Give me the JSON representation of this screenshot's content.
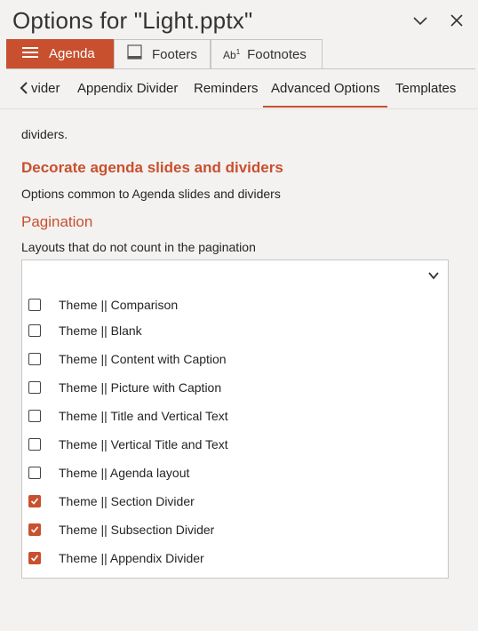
{
  "window": {
    "title": "Options for \"Light.pptx\""
  },
  "main_tabs": [
    {
      "label": "Agenda",
      "icon": "hamburger-icon",
      "active": true
    },
    {
      "label": "Footers",
      "icon": "footer-icon",
      "active": false
    },
    {
      "label": "Footnotes",
      "icon": "footnote-icon",
      "active": false
    }
  ],
  "sub_tabs": [
    {
      "label": "vider"
    },
    {
      "label": "Appendix Divider"
    },
    {
      "label": "Reminders"
    },
    {
      "label": "Advanced Options",
      "active": true
    },
    {
      "label": "Templates"
    }
  ],
  "footnotes_icon_text": "Ab",
  "content": {
    "dividers_text": "dividers.",
    "decorate_heading": "Decorate agenda slides and dividers",
    "common_text": "Options common to Agenda slides and dividers",
    "pagination_heading": "Pagination",
    "layouts_label": "Layouts that do not count in the pagination",
    "dropdown_value": ""
  },
  "layouts": [
    {
      "label": "Theme || Comparison",
      "checked": false
    },
    {
      "label": "Theme || Blank",
      "checked": false
    },
    {
      "label": "Theme || Content with Caption",
      "checked": false
    },
    {
      "label": "Theme || Picture with Caption",
      "checked": false
    },
    {
      "label": "Theme || Title and Vertical Text",
      "checked": false
    },
    {
      "label": "Theme || Vertical Title and Text",
      "checked": false
    },
    {
      "label": "Theme || Agenda layout",
      "checked": false
    },
    {
      "label": "Theme || Section Divider",
      "checked": true
    },
    {
      "label": "Theme || Subsection Divider",
      "checked": true
    },
    {
      "label": "Theme || Appendix Divider",
      "checked": true
    }
  ],
  "colors": {
    "accent": "#c8502e",
    "background": "#f3f2f1"
  }
}
